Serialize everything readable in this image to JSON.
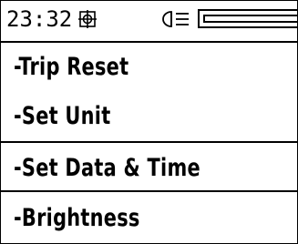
{
  "status_bar": {
    "time": "23:32",
    "icons": [
      "gps-icon",
      "light-icon",
      "battery-icon"
    ]
  },
  "menu": {
    "items": [
      {
        "label": "-Trip Reset"
      },
      {
        "label": "-Set Unit"
      },
      {
        "label": "-Set Data & Time",
        "selected": true
      },
      {
        "label": "-Brightness"
      }
    ]
  },
  "colors": {
    "foreground": "#000000",
    "background": "#ffffff"
  }
}
